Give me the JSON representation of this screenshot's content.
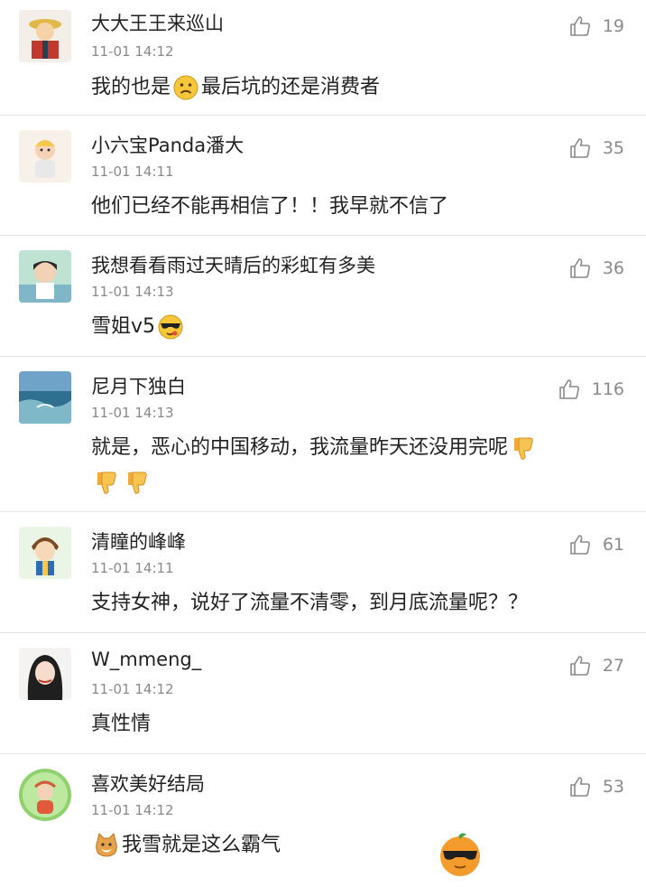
{
  "comments": [
    {
      "name": "大大王王来巡山",
      "time": "11-01 14:12",
      "likes": "19",
      "text_before": "我的也是",
      "text_after": "最后坑的还是消费者"
    },
    {
      "name": "小六宝Panda潘大",
      "time": "11-01 14:11",
      "likes": "35",
      "text": "他们已经不能再相信了！！我早就不信了"
    },
    {
      "name": "我想看看雨过天晴后的彩虹有多美",
      "time": "11-01 14:13",
      "likes": "36",
      "text": "雪姐v5"
    },
    {
      "name": "尼月下独白",
      "time": "11-01 14:13",
      "likes": "116",
      "text": "就是，恶心的中国移动，我流量昨天还没用完呢"
    },
    {
      "name": "清瞳的峰峰",
      "time": "11-01 14:11",
      "likes": "61",
      "text": "支持女神，说好了流量不清零，到月底流量呢？？"
    },
    {
      "name": "W_mmeng_",
      "time": "11-01 14:12",
      "likes": "27",
      "text": "真性情"
    },
    {
      "name": "喜欢美好结局",
      "time": "11-01 14:12",
      "likes": "53",
      "text": "我雪就是这么霸气"
    }
  ],
  "icons": {
    "like": "thumbs-up-icon",
    "emoji_sad": "sad-face-emoji",
    "emoji_cool": "cool-face-emoji",
    "emoji_thumbs_down": "thumbs-down-emoji",
    "emoji_cat": "cat-face-emoji"
  },
  "colors": {
    "text": "#222222",
    "meta": "#8a8a8a",
    "divider": "#e6e6e6"
  }
}
